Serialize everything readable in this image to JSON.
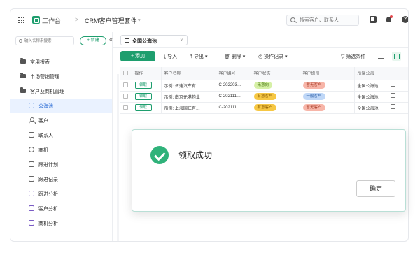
{
  "header": {
    "workbench": "工作台",
    "separator": ">",
    "suite": "CRM客户管理套件",
    "suite_caret": "▾",
    "search_placeholder": "搜索客户、联系人",
    "help": "?"
  },
  "sidebar": {
    "search_placeholder": "输入名称来搜索",
    "new_label": "+ 新建",
    "collapse": "«",
    "items": [
      {
        "label": "常用报表"
      },
      {
        "label": "市场营销管理"
      },
      {
        "label": "客户及商机管理"
      },
      {
        "label": "公海池"
      },
      {
        "label": "客户"
      },
      {
        "label": "联系人"
      },
      {
        "label": "商机"
      },
      {
        "label": "跟进计划"
      },
      {
        "label": "跟进记录"
      },
      {
        "label": "跟进分析"
      },
      {
        "label": "客户分析"
      },
      {
        "label": "商机分析"
      }
    ]
  },
  "view": {
    "current": "全国公海池",
    "caret": "∨"
  },
  "toolbar": {
    "add": "+ 添加",
    "import": "⤓ 导入",
    "export": "⤒ 导出 ▾",
    "delete": "🗑 删除 ▾",
    "log": "◷ 操作记录 ▾",
    "filter": "▽ 筛选条件"
  },
  "table": {
    "headers": [
      "操作",
      "客户名称",
      "客户编号",
      "客户状态",
      "客户级别",
      "所属公海"
    ],
    "rows": [
      {
        "action": "领取",
        "name": "示例: 伍迪汽车有…",
        "code": "C-202203…",
        "status": "无意向",
        "level": "暂无客户",
        "pool": "全国公海池"
      },
      {
        "action": "领取",
        "name": "示例: 南京元港药业",
        "code": "C-202111…",
        "status": "有意客户",
        "level": "一般客户",
        "pool": "全国公海池"
      },
      {
        "action": "领取",
        "name": "示例: 上海国仁有…",
        "code": "C-202111…",
        "status": "有意客户",
        "level": "暂无客户",
        "pool": "全国公海池"
      }
    ]
  },
  "dialog": {
    "message": "领取成功",
    "ok": "确定"
  },
  "colors": {
    "primary": "#1e9e6e",
    "active_blue": "#2f6fd6",
    "status_none_bg": "#d6f0a6",
    "status_intent_bg": "#f6c744",
    "level_none_bg": "#f7b5a8",
    "level_normal_bg": "#bfd7f7"
  }
}
